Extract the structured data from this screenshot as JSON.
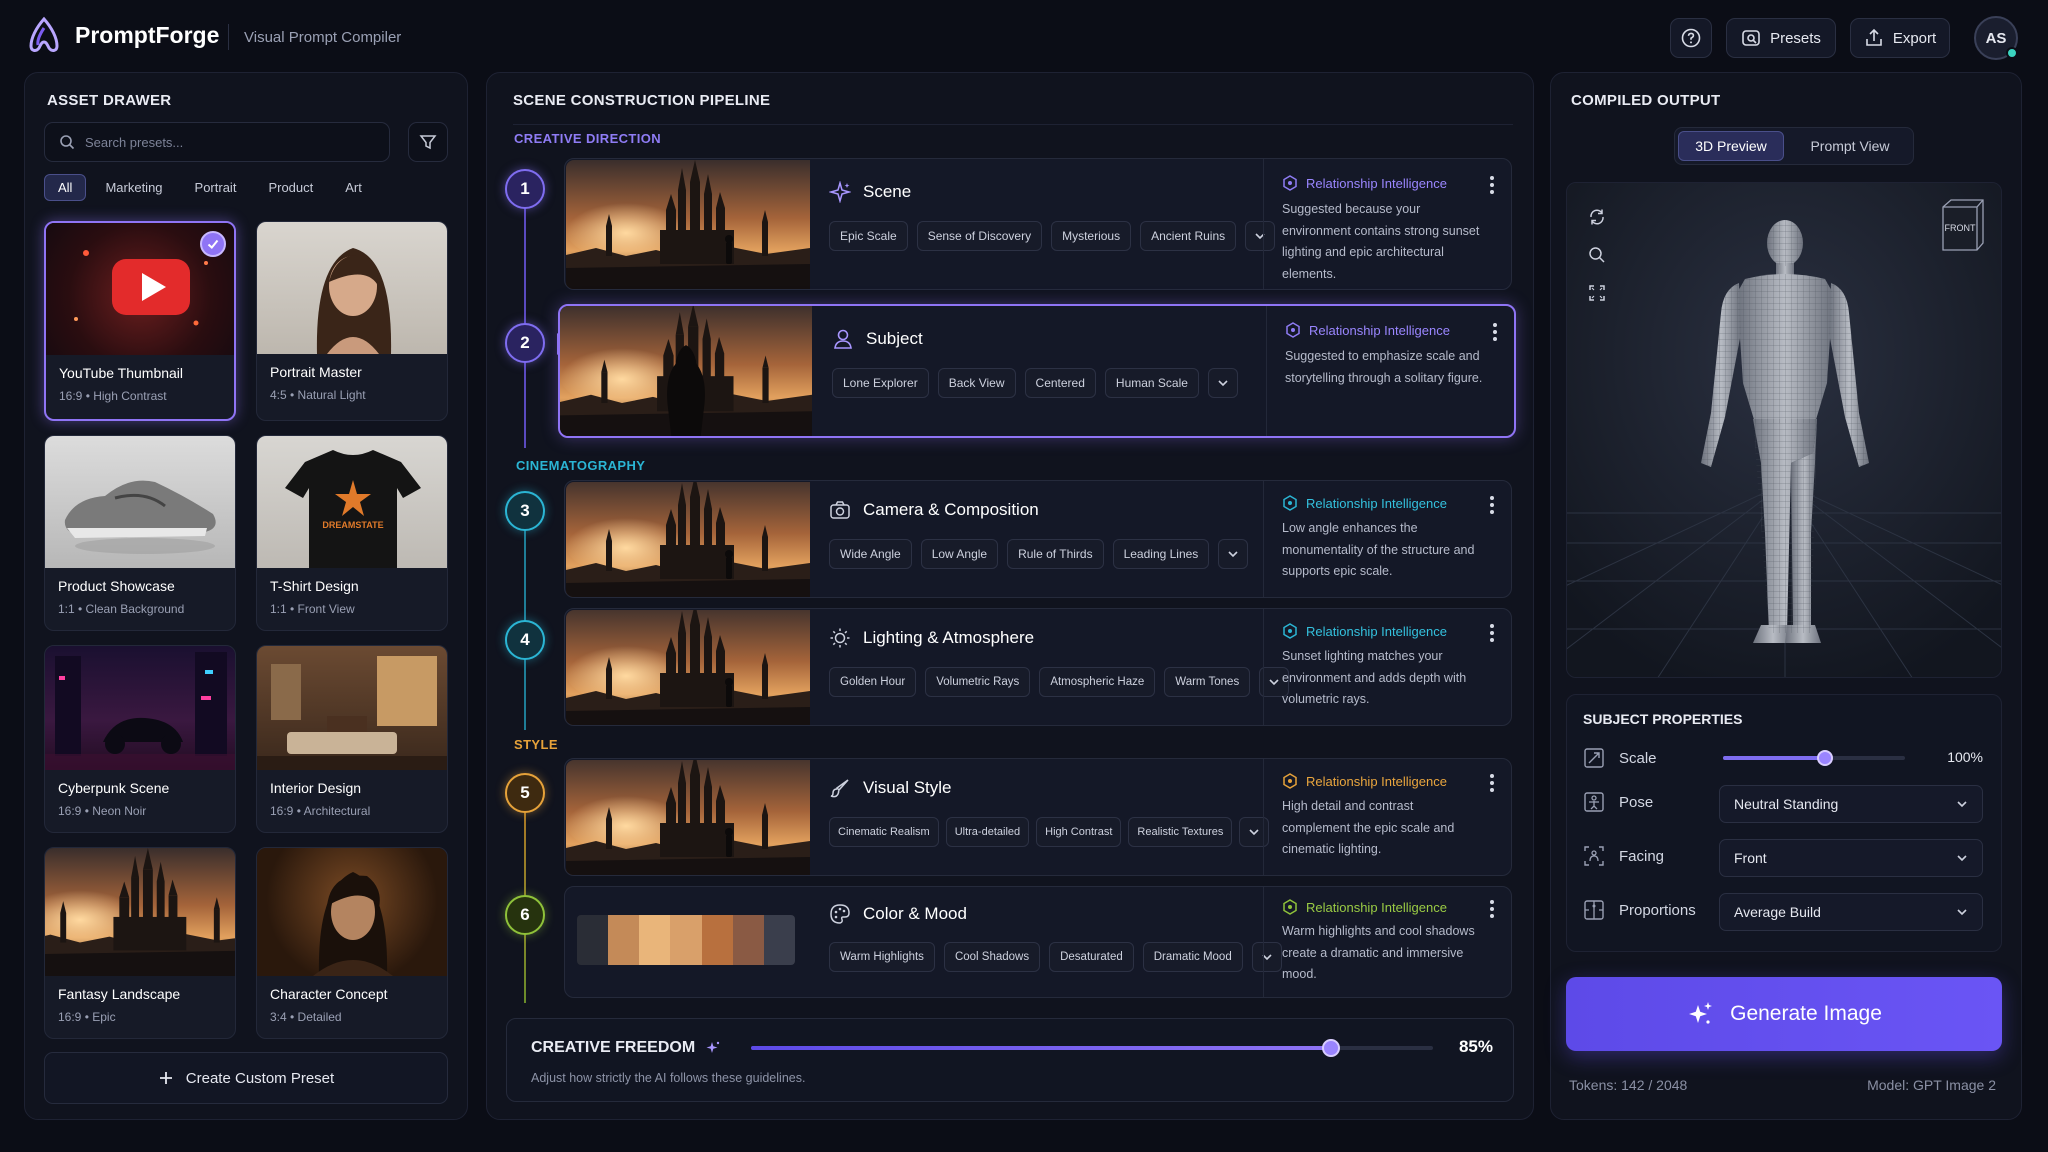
{
  "app": {
    "name": "PromptForge",
    "subtitle": "Visual Prompt Compiler",
    "avatar": "AS"
  },
  "topbar": {
    "help_icon": "help-icon",
    "presets_label": "Presets",
    "export_label": "Export"
  },
  "drawer": {
    "title": "ASSET DRAWER",
    "search_placeholder": "Search presets...",
    "filters": [
      "All",
      "Marketing",
      "Portrait",
      "Product",
      "Art"
    ],
    "active_filter": "All",
    "presets": [
      {
        "name": "YouTube Thumbnail",
        "meta": "16:9  •  High Contrast"
      },
      {
        "name": "Portrait Master",
        "meta": "4:5  •  Natural Light"
      },
      {
        "name": "Product Showcase",
        "meta": "1:1  •  Clean Background"
      },
      {
        "name": "T-Shirt Design",
        "meta": "1:1  •  Front View",
        "print": "DREAMSTATE"
      },
      {
        "name": "Cyberpunk Scene",
        "meta": "16:9  •  Neon Noir"
      },
      {
        "name": "Interior Design",
        "meta": "16:9  •  Architectural"
      },
      {
        "name": "Fantasy Landscape",
        "meta": "16:9  •  Epic"
      },
      {
        "name": "Character Concept",
        "meta": "3:4  •  Detailed"
      }
    ],
    "create_label": "Create Custom Preset"
  },
  "pipeline": {
    "title": "SCENE CONSTRUCTION PIPELINE",
    "sections": [
      "CREATIVE DIRECTION",
      "CINEMATOGRAPHY",
      "STYLE"
    ],
    "ri_label": "Relationship Intelligence",
    "steps": [
      {
        "num": "1",
        "title": "Scene",
        "icon": "sparkle-icon",
        "tags": [
          "Epic Scale",
          "Sense of Discovery",
          "Mysterious",
          "Ancient Ruins"
        ],
        "ri": "Suggested because your environment contains strong sunset lighting and epic architectural elements."
      },
      {
        "num": "2",
        "title": "Subject",
        "icon": "person-icon",
        "tags": [
          "Lone Explorer",
          "Back View",
          "Centered",
          "Human Scale"
        ],
        "ri": "Suggested to emphasize scale and storytelling through a solitary figure."
      },
      {
        "num": "3",
        "title": "Camera & Composition",
        "icon": "camera-icon",
        "tags": [
          "Wide Angle",
          "Low Angle",
          "Rule of Thirds",
          "Leading Lines"
        ],
        "ri": "Low angle enhances the monumentality of the structure and supports epic scale."
      },
      {
        "num": "4",
        "title": "Lighting & Atmosphere",
        "icon": "sun-icon",
        "tags": [
          "Golden Hour",
          "Volumetric Rays",
          "Atmospheric Haze",
          "Warm Tones"
        ],
        "ri": "Sunset lighting matches your environment and adds depth with volumetric rays."
      },
      {
        "num": "5",
        "title": "Visual Style",
        "icon": "brush-icon",
        "tags": [
          "Cinematic Realism",
          "Ultra-detailed",
          "High Contrast",
          "Realistic Textures"
        ],
        "ri": "High detail and contrast complement the epic scale and cinematic lighting."
      },
      {
        "num": "6",
        "title": "Color & Mood",
        "icon": "palette-icon",
        "tags": [
          "Warm Highlights",
          "Cool Shadows",
          "Desaturated",
          "Dramatic Mood"
        ],
        "ri": "Warm highlights and cool shadows create a dramatic and immersive mood."
      }
    ],
    "palette": [
      "#2a2d36",
      "#c48a58",
      "#e9b57a",
      "#d9a06a",
      "#b8703e",
      "#8a5a44",
      "#3a3e4c"
    ],
    "colors": {
      "step1": "#7f6df0",
      "step2": "#7f6df0",
      "step3": "#2bb5d4",
      "step4": "#2bb5d4",
      "step5": "#e6a23a",
      "step6": "#8fc23a"
    },
    "freedom": {
      "label": "CREATIVE FREEDOM",
      "value_text": "85%",
      "value": 0.85,
      "hint": "Adjust how strictly the AI follows these guidelines."
    }
  },
  "output": {
    "title": "COMPILED OUTPUT",
    "tabs": [
      "3D Preview",
      "Prompt View"
    ],
    "active_tab": "3D Preview",
    "view_badge": "FRONT",
    "props_title": "SUBJECT PROPERTIES",
    "scale_label": "Scale",
    "scale_value_text": "100%",
    "scale_value": 0.56,
    "pose_label": "Pose",
    "pose_value": "Neutral Standing",
    "facing_label": "Facing",
    "facing_value": "Front",
    "proportions_label": "Proportions",
    "proportions_value": "Average Build",
    "generate_label": "Generate Image",
    "tokens": "Tokens: 142 / 2048",
    "model": "Model: GPT Image 2"
  }
}
